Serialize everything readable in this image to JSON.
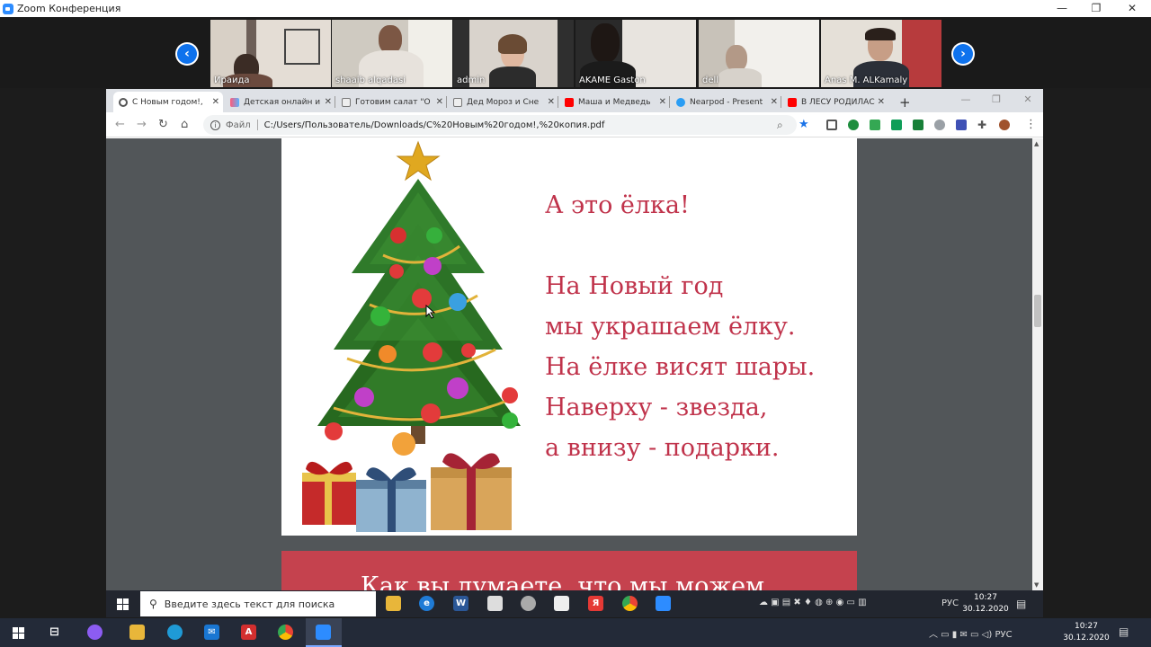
{
  "zoom": {
    "window_title": "Zoom Конференция",
    "controls": {
      "minimize": "—",
      "maximize": "❐",
      "close": "✕"
    },
    "participants": [
      {
        "name": "Ираида"
      },
      {
        "name": "shaaib alqadasi"
      },
      {
        "name": "admin"
      },
      {
        "name": "AKAME Gaston"
      },
      {
        "name": "dell"
      },
      {
        "name": "Anas M. ALKamaly"
      }
    ]
  },
  "browser": {
    "tabs": [
      {
        "label": "С Новым годом!,",
        "active": true
      },
      {
        "label": "Детская онлайн и"
      },
      {
        "label": "Готовим салат \"О"
      },
      {
        "label": "Дед Мороз и Сне"
      },
      {
        "label": "Маша и Медведь"
      },
      {
        "label": "Nearpod - Present"
      },
      {
        "label": "В ЛЕСУ РОДИЛАС"
      }
    ],
    "new_tab": "+",
    "address": {
      "scheme_label": "Файл",
      "url": "C:/Users/Пользователь/Downloads/С%20Новым%20годом!,%20копия.pdf"
    }
  },
  "pdf": {
    "poem_lines": [
      "А это ёлка!",
      "",
      "На Новый год",
      "мы украшаем ёлку.",
      "На ёлке висят шары.",
      "Наверху - звезда,",
      "а внизу - подарки."
    ],
    "next_page_text": "Как вы думаете, что мы можем"
  },
  "inner_taskbar": {
    "search_placeholder": "Введите здесь текст для поиска",
    "lang": "РУС",
    "time": "10:27",
    "date": "30.12.2020"
  },
  "outer_taskbar": {
    "lang": "РУС",
    "time": "10:27",
    "date": "30.12.2020"
  },
  "colors": {
    "poem_text": "#c0334b",
    "next_page_bg": "#c5424e",
    "zoom_blue": "#0e72ed"
  }
}
